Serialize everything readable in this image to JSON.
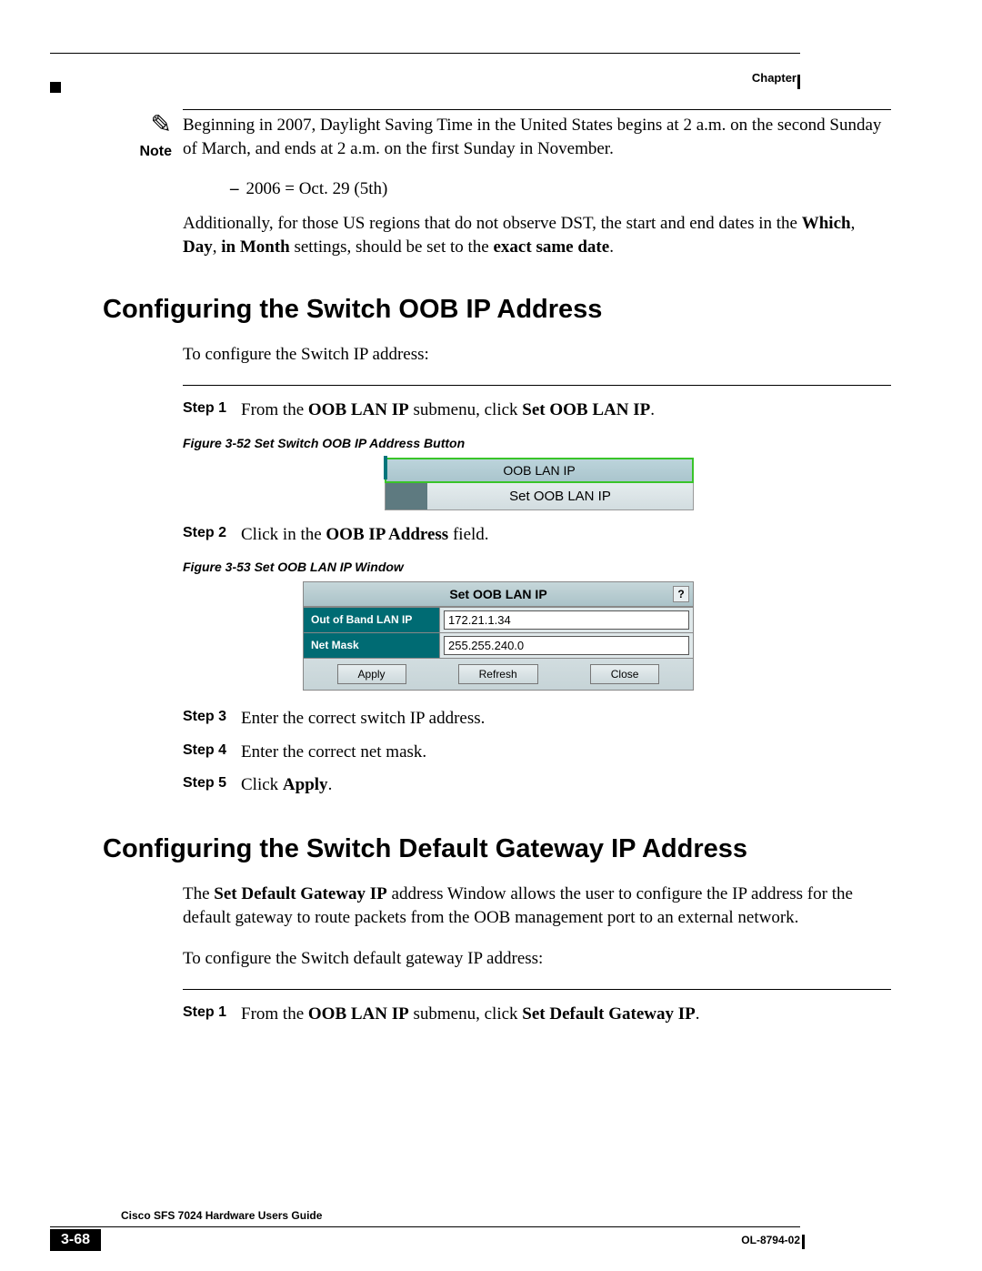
{
  "header": {
    "chapterLabel": "Chapter"
  },
  "note": {
    "label": "Note",
    "textA": "Beginning in 2007, Daylight Saving Time in the United States begins at 2 a.m. on the second Sunday of March, and ends at 2 a.m. on the first Sunday in November."
  },
  "dstBullet": "2006 = Oct. 29 (5th)",
  "dstPara": {
    "p1": "Additionally, for those US regions that do not observe DST, the start and end dates in the ",
    "b1": "Which",
    "b2": "Day",
    "b3": "in Month",
    "p2": " settings, should be set to the ",
    "b4": "exact same date",
    "p3": "."
  },
  "section1": {
    "heading": "Configuring the Switch OOB IP Address",
    "intro": "To configure the Switch IP address:",
    "steps": {
      "s1a": "From the ",
      "s1b": "OOB LAN IP",
      "s1c": " submenu, click ",
      "s1d": "Set OOB LAN IP",
      "s1e": ".",
      "s2a": "Click in the ",
      "s2b": "OOB IP Address",
      "s2c": " field.",
      "s3": "Enter the correct switch IP address.",
      "s4": "Enter the correct net mask.",
      "s5a": "Click ",
      "s5b": "Apply",
      "s5c": "."
    },
    "stepLabels": {
      "s1": "Step 1",
      "s2": "Step 2",
      "s3": "Step 3",
      "s4": "Step 4",
      "s5": "Step 5"
    }
  },
  "fig52": {
    "caption": "Figure 3-52   Set Switch OOB IP Address Button",
    "menuHeader": "OOB LAN IP",
    "menuItem": "Set OOB LAN IP"
  },
  "fig53": {
    "caption": "Figure 3-53   Set OOB LAN IP Window",
    "title": "Set OOB LAN IP",
    "help": "?",
    "row1Label": "Out of Band LAN IP",
    "row1Value": "172.21.1.34",
    "row2Label": "Net Mask",
    "row2Value": "255.255.240.0",
    "buttons": {
      "apply": "Apply",
      "refresh": "Refresh",
      "close": "Close"
    }
  },
  "section2": {
    "heading": "Configuring the Switch Default Gateway IP Address",
    "para1a": "The ",
    "para1b": "Set Default Gateway IP",
    "para1c": " address Window allows the user to configure the IP address for the default gateway to route packets from the OOB management port to an external network.",
    "para2": "To configure the Switch default gateway IP address:",
    "s1Label": "Step 1",
    "s1a": "From the ",
    "s1b": "OOB LAN IP",
    "s1c": " submenu, click ",
    "s1d": "Set Default Gateway IP",
    "s1e": "."
  },
  "footer": {
    "guide": "Cisco SFS 7024 Hardware Users Guide",
    "page": "3-68",
    "docid": "OL-8794-02"
  }
}
